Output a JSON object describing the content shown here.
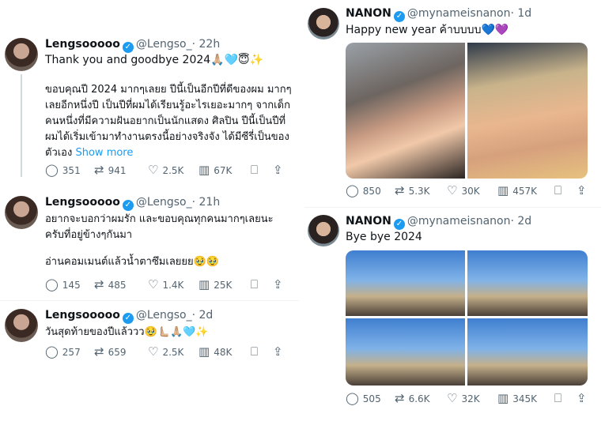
{
  "left": {
    "tweets": [
      {
        "name": "Lengsooooo",
        "handle": "@Lengso_",
        "time": "· 22h",
        "line1": "Thank you and goodbye 2024🙏🏼🩵😇✨",
        "text": "ขอบคุณปี 2024 มากๆเลยย ปีนี้เป็นอีกปีที่ดีของผม มากๆเลยอีกหนึ่งปี เป็นปีที่ผมได้เรียนรู้อะไรเยอะมากๆ จากเด็กคนหนึ่งที่มีความฝันอยากเป็นนักแสดง ศิลปิน ปีนี้เป็นปีที่ผมได้เริ่มเข้ามาทำงานตรงนี้อย่างจริงจัง ได้มีซีรี่เป็นของตัวเอง",
        "show_more": "Show more",
        "replies": "351",
        "reposts": "941",
        "likes": "2.5K",
        "views": "67K"
      },
      {
        "name": "Lengsooooo",
        "handle": "@Lengso_",
        "time": "· 21h",
        "text": "อยากจะบอกว่าผมรัก และขอบคุณทุกคนมากๆเลยนะ ครับที่อยู่ข้างๆกันมา",
        "text2": "อ่านคอมเมนต์แล้วน้ำตาซึมเลยยย🥹🥹",
        "replies": "145",
        "reposts": "485",
        "likes": "1.4K",
        "views": "25K"
      },
      {
        "name": "Lengsooooo",
        "handle": "@Lengso_",
        "time": "· 2d",
        "text": "วันสุดท้ายของปีแล้ววว🥹🫷🏼🙏🏼🩵✨",
        "replies": "257",
        "reposts": "659",
        "likes": "2.5K",
        "views": "48K"
      }
    ]
  },
  "right": {
    "tweets": [
      {
        "name": "NANON",
        "handle": "@mynameisnanon",
        "time": "· 1d",
        "text": "Happy new year ค้าบบบบ💙💜",
        "replies": "850",
        "reposts": "5.3K",
        "likes": "30K",
        "views": "457K"
      },
      {
        "name": "NANON",
        "handle": "@mynameisnanon",
        "time": "· 2d",
        "text": "Bye bye 2024",
        "replies": "505",
        "reposts": "6.6K",
        "likes": "32K",
        "views": "345K"
      }
    ]
  },
  "icons": {
    "reply": "reply-icon",
    "repost": "repost-icon",
    "like": "heart-icon",
    "views": "views-icon",
    "bookmark": "bookmark-icon",
    "share": "share-icon",
    "verified": "verified-badge-icon"
  },
  "colors": {
    "verified": "#1d9bf0",
    "muted": "#536471",
    "link": "#1d9bf0"
  }
}
